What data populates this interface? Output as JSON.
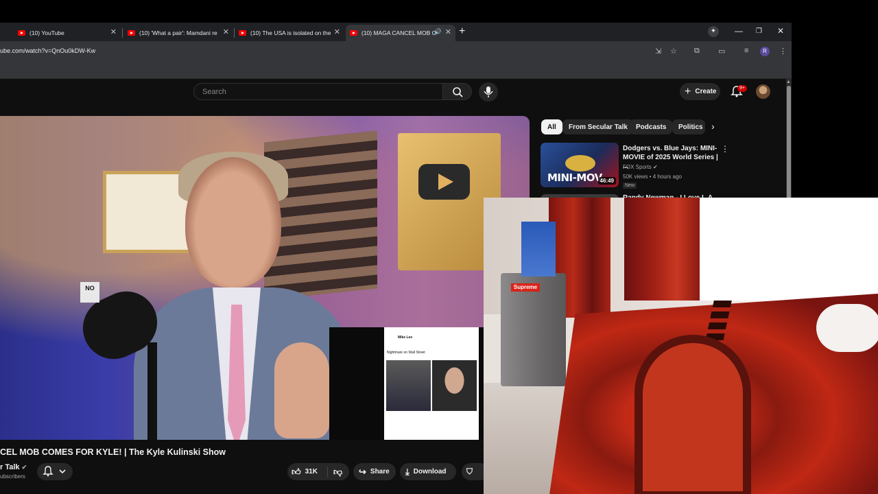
{
  "browser": {
    "tabs": [
      {
        "title": "(10) YouTube"
      },
      {
        "title": "(10) 'What a pair': Mamdani re"
      },
      {
        "title": "(10) The USA is isolated on the"
      },
      {
        "title": "(10) MAGA CANCEL MOB C"
      }
    ],
    "url": "ube.com/watch?v=QnOu0kDW-Kw",
    "profile_initial": "R"
  },
  "youtube": {
    "search_placeholder": "Search",
    "create_label": "Create",
    "notification_count": "9+",
    "video": {
      "title": "CEL MOB COMES FOR KYLE! | The Kyle Kulinski Show",
      "channel": "r Talk",
      "subscribers": "ubscribers",
      "likes": "31K",
      "share_label": "Share",
      "download_label": "Download",
      "overlay_sign": "NO",
      "tweet_author": "Mike Lee",
      "tweet_text": "Nightmare on Wall Street"
    },
    "chips": [
      {
        "label": "All",
        "active": true
      },
      {
        "label": "From Secular Talk",
        "active": false
      },
      {
        "label": "Podcasts",
        "active": false
      },
      {
        "label": "Politics",
        "active": false
      }
    ],
    "related": [
      {
        "title": "Dodgers vs. Blue Jays: MINI-MOVIE of 2025 World Series | ...",
        "channel": "FOX Sports",
        "meta": "50K views • 4 hours ago",
        "badge": "New",
        "duration": "46:49",
        "thumb_text": "MINI-MOV"
      },
      {
        "title": "Randy Newman - I Love L.A."
      }
    ]
  },
  "webcam": {
    "sticker_text": "Supreme"
  }
}
